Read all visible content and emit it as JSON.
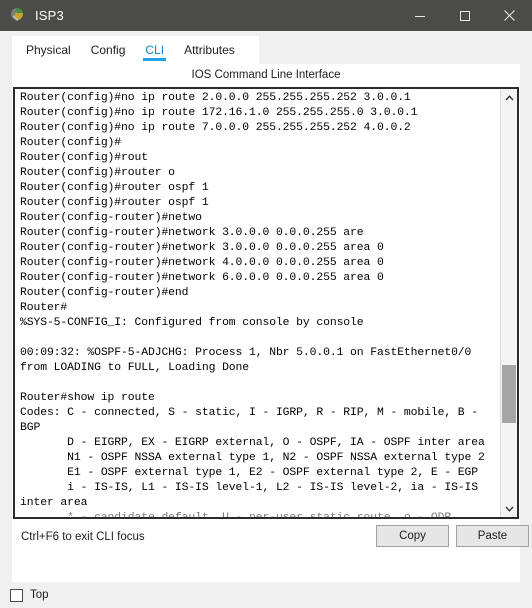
{
  "window": {
    "title": "ISP3",
    "icon": "packet-tracer-device-icon",
    "controls": {
      "minimize": "minimize-icon",
      "maximize": "maximize-icon",
      "close": "close-icon"
    },
    "colors": {
      "titlebar_bg": "#4b4b49",
      "accent": "#22a3e0",
      "panel_bg": "#ffffff",
      "app_bg": "#f0f0f0"
    }
  },
  "tabs": [
    {
      "label": "Physical",
      "active": false
    },
    {
      "label": "Config",
      "active": false
    },
    {
      "label": "CLI",
      "active": true
    },
    {
      "label": "Attributes",
      "active": false
    }
  ],
  "panel": {
    "heading": "IOS Command Line Interface"
  },
  "terminal": {
    "lines": [
      "Router(config)#no ip route 2.0.0.0 255.255.255.252 3.0.0.1",
      "Router(config)#no ip route 172.16.1.0 255.255.255.0 3.0.0.1",
      "Router(config)#no ip route 7.0.0.0 255.255.255.252 4.0.0.2",
      "Router(config)#",
      "Router(config)#rout",
      "Router(config)#router o",
      "Router(config)#router ospf 1",
      "Router(config)#router ospf 1",
      "Router(config-router)#netwo",
      "Router(config-router)#network 3.0.0.0 0.0.0.255 are",
      "Router(config-router)#network 3.0.0.0 0.0.0.255 area 0",
      "Router(config-router)#network 4.0.0.0 0.0.0.255 area 0",
      "Router(config-router)#network 6.0.0.0 0.0.0.255 area 0",
      "Router(config-router)#end",
      "Router#",
      "%SYS-5-CONFIG_I: Configured from console by console",
      "",
      "00:09:32: %OSPF-5-ADJCHG: Process 1, Nbr 5.0.0.1 on FastEthernet0/0",
      "from LOADING to FULL, Loading Done",
      "",
      "Router#show ip route",
      "Codes: C - connected, S - static, I - IGRP, R - RIP, M - mobile, B -",
      "BGP",
      "       D - EIGRP, EX - EIGRP external, O - OSPF, IA - OSPF inter area",
      "       N1 - OSPF NSSA external type 1, N2 - OSPF NSSA external type 2",
      "       E1 - OSPF external type 1, E2 - OSPF external type 2, E - EGP",
      "       i - IS-IS, L1 - IS-IS level-1, L2 - IS-IS level-2, ia - IS-IS",
      "inter area"
    ],
    "clipped_line": "       * - candidate default, U - per-user static route, o - ODR",
    "scrollbar": {
      "up_arrow": "chevron-up-icon",
      "down_arrow": "chevron-down-icon"
    }
  },
  "footer": {
    "hint": "Ctrl+F6 to exit CLI focus",
    "copy_label": "Copy",
    "paste_label": "Paste"
  },
  "bottom": {
    "top_checkbox_label": "Top",
    "top_checked": false
  }
}
